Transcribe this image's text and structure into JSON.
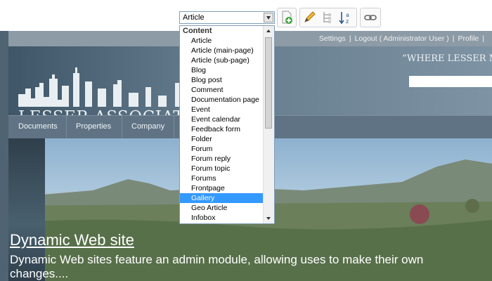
{
  "toolbar": {
    "content_type_select": {
      "value": "Article"
    },
    "buttons": [
      {
        "icon": "add-page-icon"
      },
      {
        "icon": "pencil-icon"
      },
      {
        "icon": "tree-icon"
      },
      {
        "icon": "sort-az-icon"
      },
      {
        "icon": "link-icon"
      }
    ]
  },
  "dropdown": {
    "group_label": "Content",
    "items": [
      "Article",
      "Article (main-page)",
      "Article (sub-page)",
      "Blog",
      "Blog post",
      "Comment",
      "Documentation page",
      "Event",
      "Event calendar",
      "Feedback form",
      "Folder",
      "Forum",
      "Forum reply",
      "Forum topic",
      "Forums",
      "Frontpage",
      "Gallery",
      "Geo Article",
      "Infobox"
    ],
    "selected": "Gallery"
  },
  "site": {
    "top_links": [
      "Settings",
      "Logout ( Administrator User )",
      "Profile"
    ],
    "logo_text": "LESSER ASSOCIATES LLC",
    "tagline": "“WHERE LESSER MEA",
    "nav": [
      "Documents",
      "Properties",
      "Company"
    ],
    "banner": {
      "title": "Dynamic Web site",
      "text": "Dynamic Web sites feature an admin module, allowing uses to make their own changes...."
    }
  },
  "colors": {
    "selected": "#3399ff",
    "header": "#637b8c",
    "nav": "#5f7384"
  }
}
